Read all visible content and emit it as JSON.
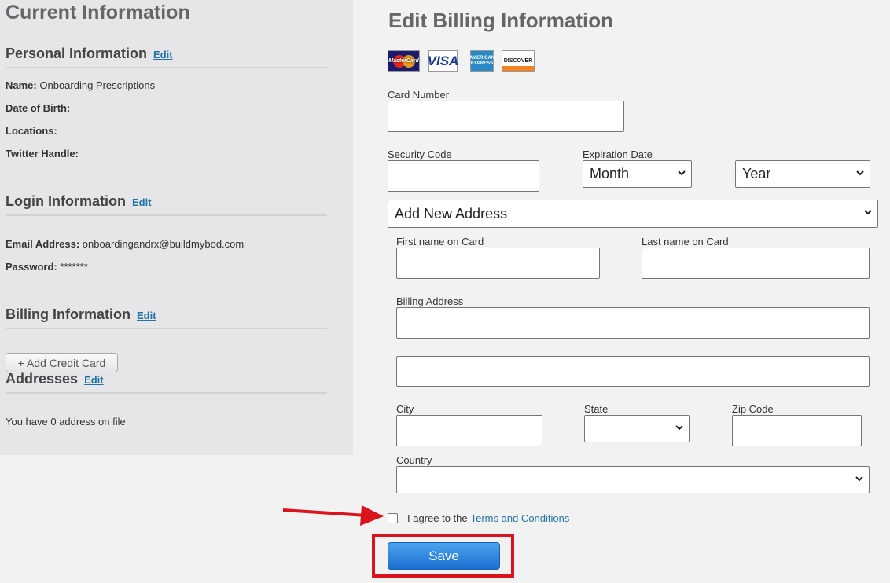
{
  "current": {
    "title": "Current Information",
    "personal": {
      "title": "Personal Information",
      "edit": "Edit",
      "name_label": "Name:",
      "name_value": "Onboarding Prescriptions",
      "dob_label": "Date of Birth:",
      "locations_label": "Locations:",
      "twitter_label": "Twitter Handle:"
    },
    "login": {
      "title": "Login Information",
      "edit": "Edit",
      "email_label": "Email Address:",
      "email_value": "onboardingandrx@buildmybod.com",
      "password_label": "Password:",
      "password_value": "*******"
    },
    "billing": {
      "title": "Billing Information",
      "edit": "Edit",
      "add_card": "+ Add Credit Card"
    },
    "addresses": {
      "title": "Addresses",
      "edit": "Edit",
      "summary": "You have 0 address on file"
    }
  },
  "form": {
    "title": "Edit Billing Information",
    "card_logos": {
      "mastercard": "MasterCard",
      "visa": "VISA",
      "amex": "AMERICAN EXPRESS",
      "discover": "DISCOVER"
    },
    "card_number_label": "Card Number",
    "security_code_label": "Security Code",
    "expiration_label": "Expiration Date",
    "month_value": "Month",
    "year_value": "Year",
    "address_select_value": "Add New Address",
    "first_name_label": "First name on Card",
    "last_name_label": "Last name on Card",
    "billing_address_label": "Billing Address",
    "city_label": "City",
    "state_label": "State",
    "zip_label": "Zip Code",
    "country_label": "Country",
    "agree_text": "I agree to the",
    "terms_link": "Terms and Conditions",
    "save_label": "Save"
  },
  "colors": {
    "annotation_red": "#d9141c",
    "link_blue": "#2273a8",
    "save_blue": "#1a6fd0"
  },
  "icons": [
    "mastercard-logo-icon",
    "visa-logo-icon",
    "amex-logo-icon",
    "discover-logo-icon",
    "chevron-down-icon",
    "red-arrow-icon"
  ]
}
